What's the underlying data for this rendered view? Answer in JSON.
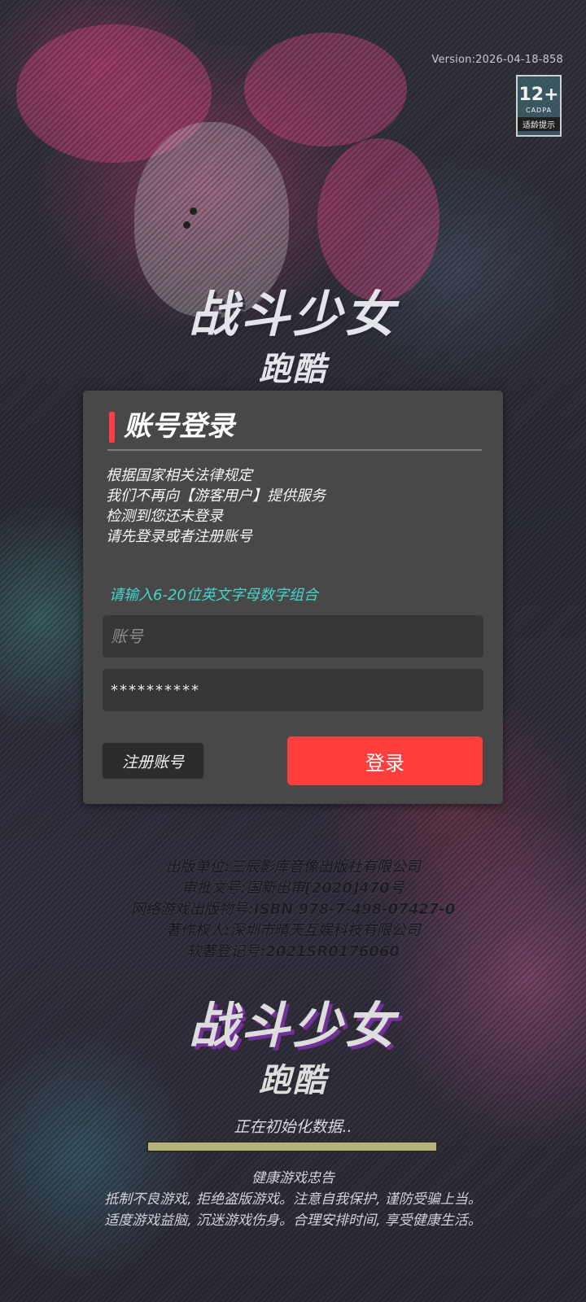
{
  "version": "Version:2026-04-18-858",
  "age_rating": {
    "number": "12+",
    "org": "CADPA",
    "tip": "适龄提示"
  },
  "logo": {
    "title": "战斗少女",
    "subtitle": "跑酷"
  },
  "login": {
    "title": "账号登录",
    "notice": [
      "根据国家相关法律规定",
      "我们不再向【游客用户】提供服务",
      "检测到您还未登录",
      "请先登录或者注册账号"
    ],
    "hint": "请输入6-20位英文字母数字组合",
    "account_placeholder": "账号",
    "account_value": "",
    "password_value": "**********",
    "register_label": "注册账号",
    "login_label": "登录"
  },
  "publishing": [
    "出版单位:三辰影库音像出版社有限公司",
    "审批文号:国新出审[2020]470号",
    "网络游戏出版物号:ISBN 978-7-498-07427-0",
    "著作权人:深圳市晴天互娱科技有限公司",
    "软著登记号:2021SR0176060"
  ],
  "loading": {
    "text": "正在初始化数据..",
    "progress": 1.0
  },
  "health_advice": [
    "健康游戏忠告",
    "抵制不良游戏, 拒绝盗版游戏。注意自我保护, 谨防受骗上当。",
    "适度游戏益脑, 沉迷游戏伤身。合理安排时间, 享受健康生活。"
  ],
  "colors": {
    "accent_red": "#ff3e3e",
    "hint_cyan": "#44d4c8",
    "card_bg": "#484848"
  }
}
